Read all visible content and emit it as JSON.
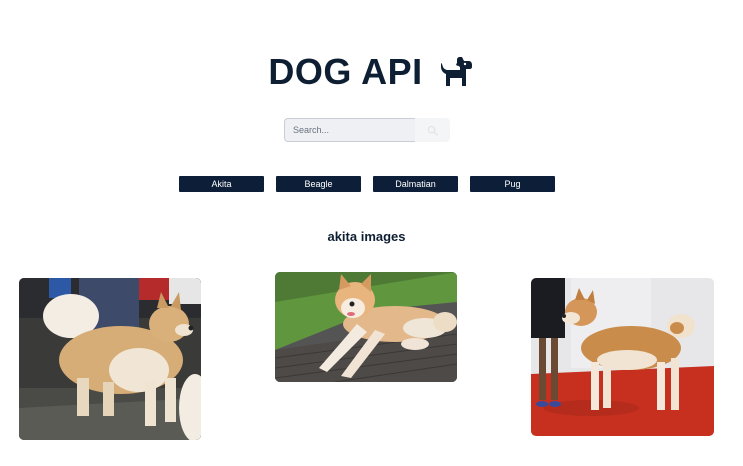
{
  "header": {
    "title": "DOG API",
    "logo_icon": "dog-icon"
  },
  "search": {
    "placeholder": "Search...",
    "value": "",
    "button_icon": "search-icon"
  },
  "breeds": {
    "buttons": [
      {
        "label": "Akita"
      },
      {
        "label": "Beagle"
      },
      {
        "label": "Dalmatian"
      },
      {
        "label": "Pug"
      }
    ]
  },
  "gallery": {
    "heading": "akita images",
    "images": [
      {
        "alt": "akita dog standing"
      },
      {
        "alt": "akita dog lying on deck"
      },
      {
        "alt": "akita dog at show"
      }
    ]
  },
  "colors": {
    "primary": "#0d1f38",
    "text": "#0f1f33",
    "background": "#ffffff"
  }
}
